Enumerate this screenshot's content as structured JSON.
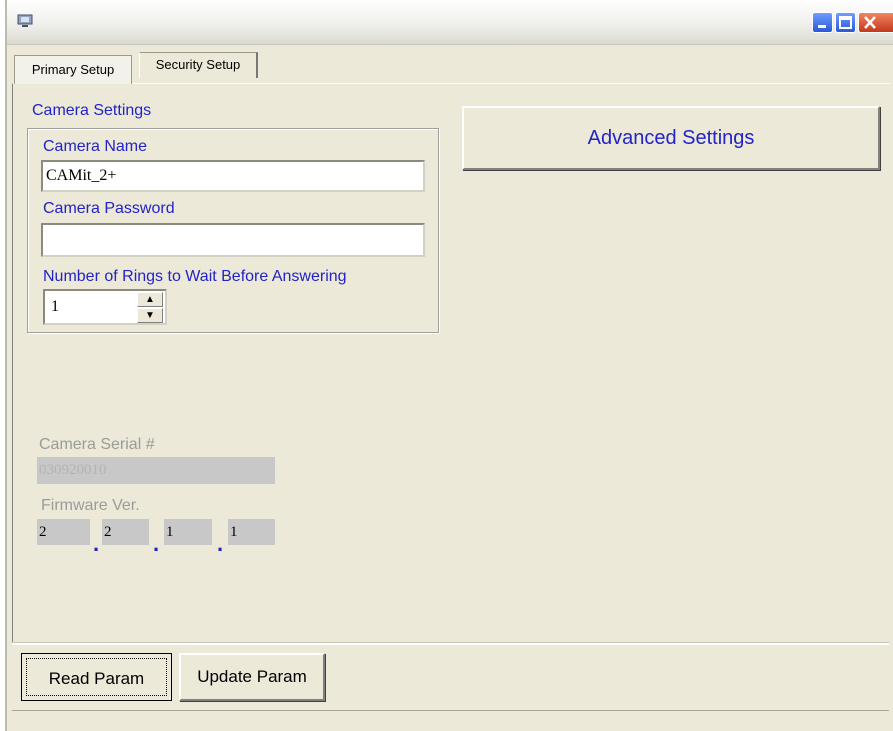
{
  "window": {
    "app_icon": "camera-app-icon",
    "controls": [
      "minimize-icon",
      "maximize-icon",
      "close-icon"
    ]
  },
  "tabs": [
    {
      "label": "Primary Setup",
      "selected": true
    },
    {
      "label": "Security Setup",
      "selected": false
    }
  ],
  "camera_settings": {
    "group_title": "Camera Settings",
    "name_label": "Camera Name",
    "name_value": "CAMit_2+",
    "password_label": "Camera Password",
    "password_value": "",
    "rings_label": "Number of Rings to Wait Before Answering",
    "rings_value": "1"
  },
  "advanced_button": "Advanced Settings",
  "serial": {
    "label": "Camera Serial #",
    "value": "030920010"
  },
  "firmware": {
    "label": "Firmware Ver.",
    "parts": [
      "2",
      "2",
      "1",
      "1"
    ],
    "separator": "."
  },
  "buttons": {
    "read": "Read Param",
    "update": "Update Param"
  },
  "colors": {
    "label_blue": "#2323c8",
    "disabled_gray": "#9b9b9b",
    "window_bg": "#ece9d8"
  }
}
